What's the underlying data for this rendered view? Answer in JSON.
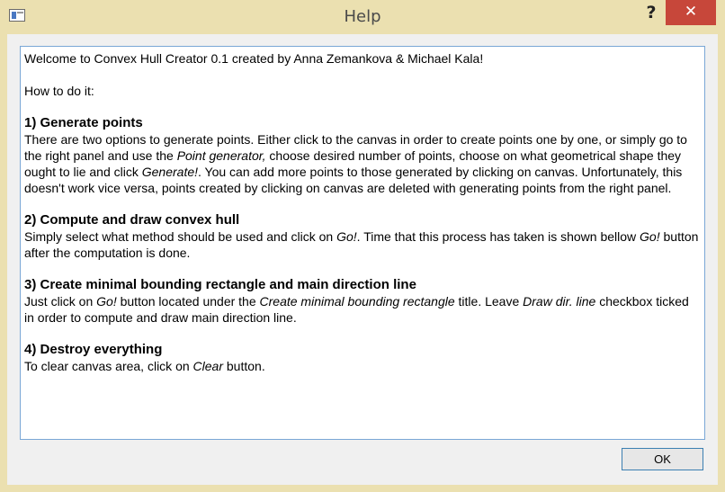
{
  "window": {
    "title": "Help",
    "help_glyph": "?",
    "close_glyph": "✕",
    "icon": "app-window-icon",
    "frame_color": "#ebe0b0",
    "close_color": "#c7473a"
  },
  "content": {
    "intro": "Welcome to Convex Hull Creator 0.1 created by Anna Zemankova & Michael Kala!",
    "how_to": "How to do it:",
    "section1": {
      "heading": "1) Generate points",
      "t1": "There are two options to generate points. Either click to the canvas in order to create points one by one, or simply go to the right panel and use the ",
      "i1": "Point generator,",
      "t2": " choose desired number of points, choose on what geometrical shape they ought to lie and click ",
      "i2": "Generate!",
      "t3": ". You can add more points to those generated by clicking on canvas. Unfortunately, this doesn't work vice versa, points created by clicking on canvas are deleted with generating points from the right panel."
    },
    "section2": {
      "heading": "2) Compute and draw convex hull",
      "t1": "Simply select what method should be used and click on ",
      "i1": "Go!",
      "t2": ". Time that this process has taken is shown bellow ",
      "i2": "Go!",
      "t3": " button after the computation is done."
    },
    "section3": {
      "heading": "3) Create minimal bounding rectangle and main direction line",
      "t1": "Just click on ",
      "i1": "Go!",
      "t2": " button located under the ",
      "i2": "Create minimal bounding rectangle",
      "t3": " title. Leave ",
      "i3": "Draw dir. line",
      "t4": " checkbox ticked in order to compute and draw main direction line."
    },
    "section4": {
      "heading": "4) Destroy everything",
      "t1": "To clear canvas area, click on ",
      "i1": "Clear",
      "t2": " button."
    }
  },
  "ok_button": "OK"
}
